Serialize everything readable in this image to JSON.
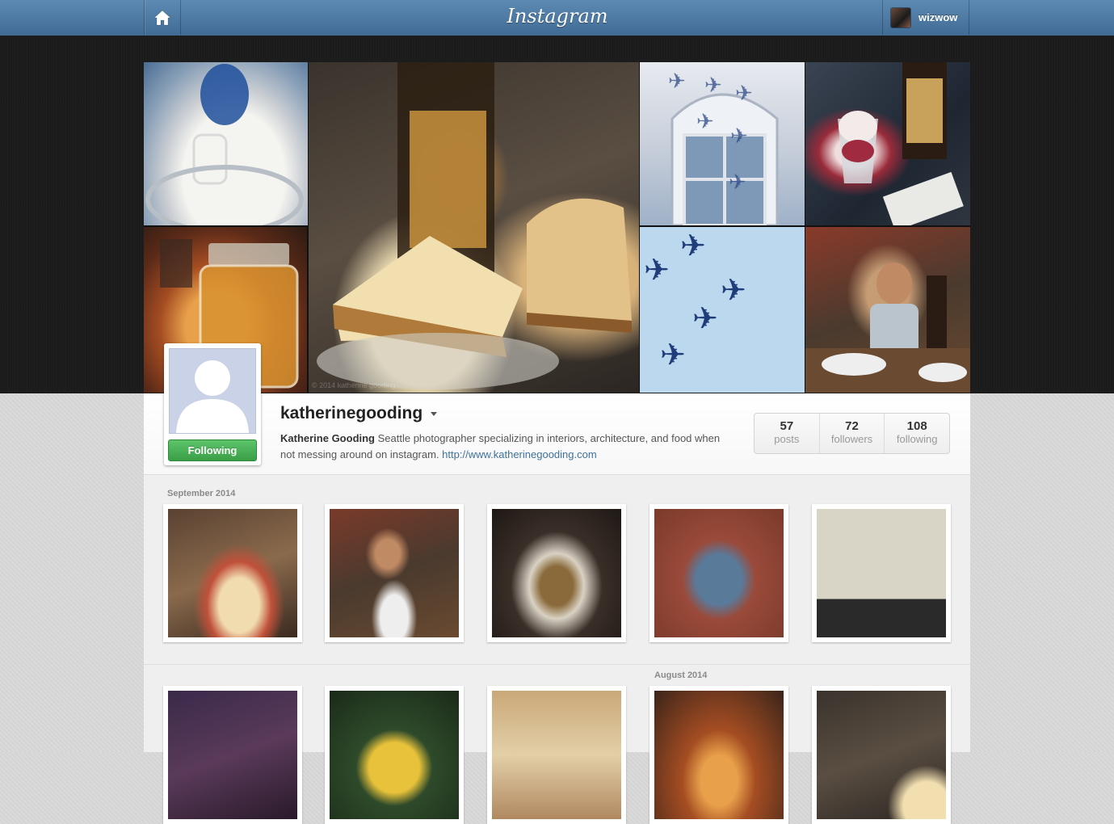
{
  "topbar": {
    "logo": "Instagram",
    "home_icon": "home-icon",
    "user": {
      "name": "wizwow",
      "avatar": "user-avatar"
    }
  },
  "cover": {
    "watermark": "© 2014 katherine gooding"
  },
  "profile": {
    "username": "katherinegooding",
    "full_name": "Katherine Gooding",
    "bio": " Seattle photographer specializing in interiors, architecture, and food when not messing around on instagram. ",
    "website": "http://www.katherinegooding.com",
    "follow_button": "Following",
    "follow_button_color": "#4cb35a",
    "stats": [
      {
        "num": "57",
        "label": "posts"
      },
      {
        "num": "72",
        "label": "followers"
      },
      {
        "num": "108",
        "label": "following"
      }
    ]
  },
  "feed": {
    "sections": [
      {
        "label": "September 2014"
      },
      {
        "label": "August 2014"
      }
    ]
  },
  "colors": {
    "topbar": "#4a76a0",
    "link": "#3f729b",
    "band": "#1b1b1b"
  }
}
